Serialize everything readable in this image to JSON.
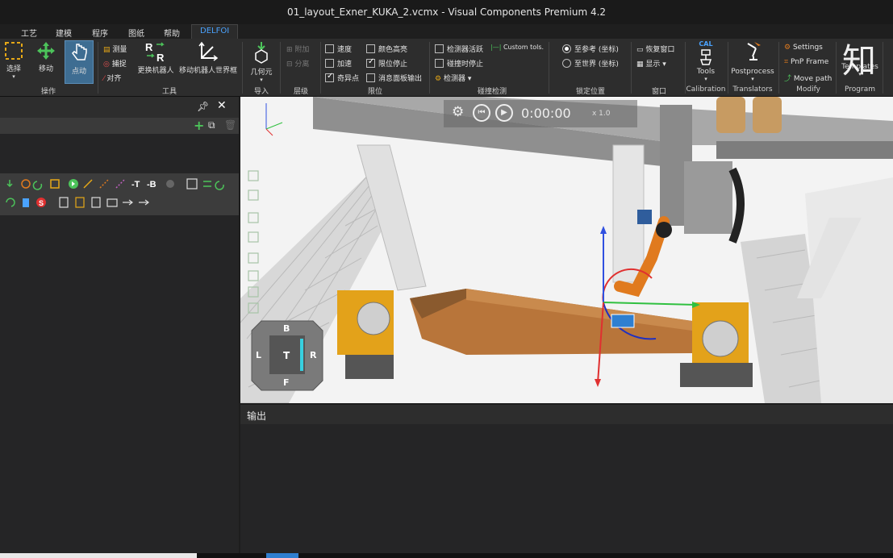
{
  "window": {
    "title": "01_layout_Exner_KUKA_2.vcmx - Visual Components Premium 4.2"
  },
  "menu_tabs": [
    {
      "label": "工艺"
    },
    {
      "label": "建模"
    },
    {
      "label": "程序"
    },
    {
      "label": "图纸"
    },
    {
      "label": "帮助"
    },
    {
      "label": "DELFOI",
      "active": true
    }
  ],
  "ribbon": {
    "operate": {
      "select": "选择",
      "move": "移动",
      "jog": "点动",
      "group": "操作"
    },
    "tools": {
      "measure": "测量",
      "snap": "捕捉",
      "align": "对齐",
      "swap_robot": "更换机器人",
      "move_robot_world": "移动机器人世界框",
      "group": "工具"
    },
    "import": {
      "geometry": "几何元",
      "group": "导入"
    },
    "level": {
      "attach": "附加",
      "detach": "分离",
      "group": "层级"
    },
    "limits": {
      "speed": "速度",
      "accel": "加速",
      "singularity": "奇异点",
      "color_highlight": "颜色高亮",
      "limit_stop": "限位停止",
      "msg_panel_output": "消息面板输出",
      "group": "限位"
    },
    "collision": {
      "detector_active": "检测器活跃",
      "custom_tols": "Custom tols.",
      "stop_on_collision": "碰撞时停止",
      "detector": "检测器",
      "group": "碰撞检测"
    },
    "lock": {
      "to_reference": "至参考 (坐标)",
      "to_world": "至世界 (坐标)",
      "group": "锁定位置"
    },
    "window": {
      "restore": "恢复窗口",
      "show": "显示",
      "group": "窗口"
    },
    "calibration": {
      "badge": "CAL",
      "tools": "Tools",
      "group": "Calibration"
    },
    "translators": {
      "postprocess": "Postprocess",
      "group": "Translators"
    },
    "modify": {
      "settings": "Settings",
      "pnp_frame": "PnP Frame",
      "move_path": "Move path",
      "group": "Modify"
    },
    "program": {
      "templates": "Templates",
      "group": "Program"
    }
  },
  "viewport": {
    "timer": "0:00:00",
    "speed": "x 1.0",
    "nav_cube": {
      "top": "B",
      "left": "L",
      "center": "T",
      "right": "R",
      "bottom": "F"
    }
  },
  "output_panel": {
    "title": "输出"
  },
  "watermark": "知",
  "colors": {
    "accent": "#4aa3ff",
    "robot_orange": "#e07a1e",
    "part_brown": "#b8753a",
    "fixture_yellow": "#e3a21a"
  }
}
